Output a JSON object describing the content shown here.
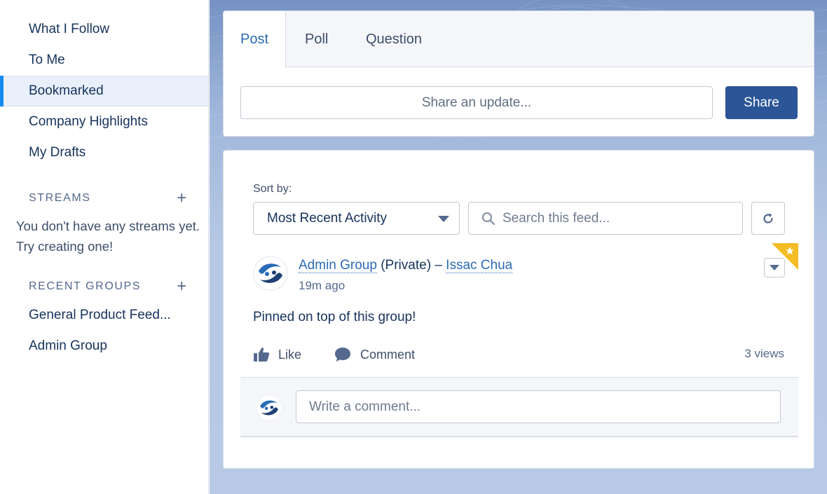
{
  "sidebar": {
    "items": [
      {
        "label": "What I Follow"
      },
      {
        "label": "To Me"
      },
      {
        "label": "Bookmarked",
        "selected": true
      },
      {
        "label": "Company Highlights"
      },
      {
        "label": "My Drafts"
      }
    ],
    "streams": {
      "heading": "STREAMS",
      "add": "+",
      "empty_text": "You don't have any streams yet. Try creating one!"
    },
    "recent_groups": {
      "heading": "RECENT GROUPS",
      "add": "+",
      "items": [
        {
          "label": "General Product Feed..."
        },
        {
          "label": "Admin Group"
        }
      ]
    }
  },
  "publisher": {
    "tabs": [
      {
        "label": "Post",
        "active": true
      },
      {
        "label": "Poll"
      },
      {
        "label": "Question"
      }
    ],
    "input_placeholder": "Share an update...",
    "share_label": "Share"
  },
  "feed": {
    "sort_label": "Sort by:",
    "sort_value": "Most Recent Activity",
    "search_placeholder": "Search this feed...",
    "post": {
      "group": "Admin Group",
      "visibility": "(Private)",
      "separator": "–",
      "author": "Issac Chua",
      "time": "19m ago",
      "body": "Pinned on top of this group!",
      "like_label": "Like",
      "comment_label": "Comment",
      "views": "3 views",
      "comment_placeholder": "Write a comment..."
    }
  },
  "colors": {
    "accent": "#1589ee",
    "share_button": "#2b5597",
    "link": "#2a6ab7",
    "pin_flag": "#f4bc25"
  }
}
